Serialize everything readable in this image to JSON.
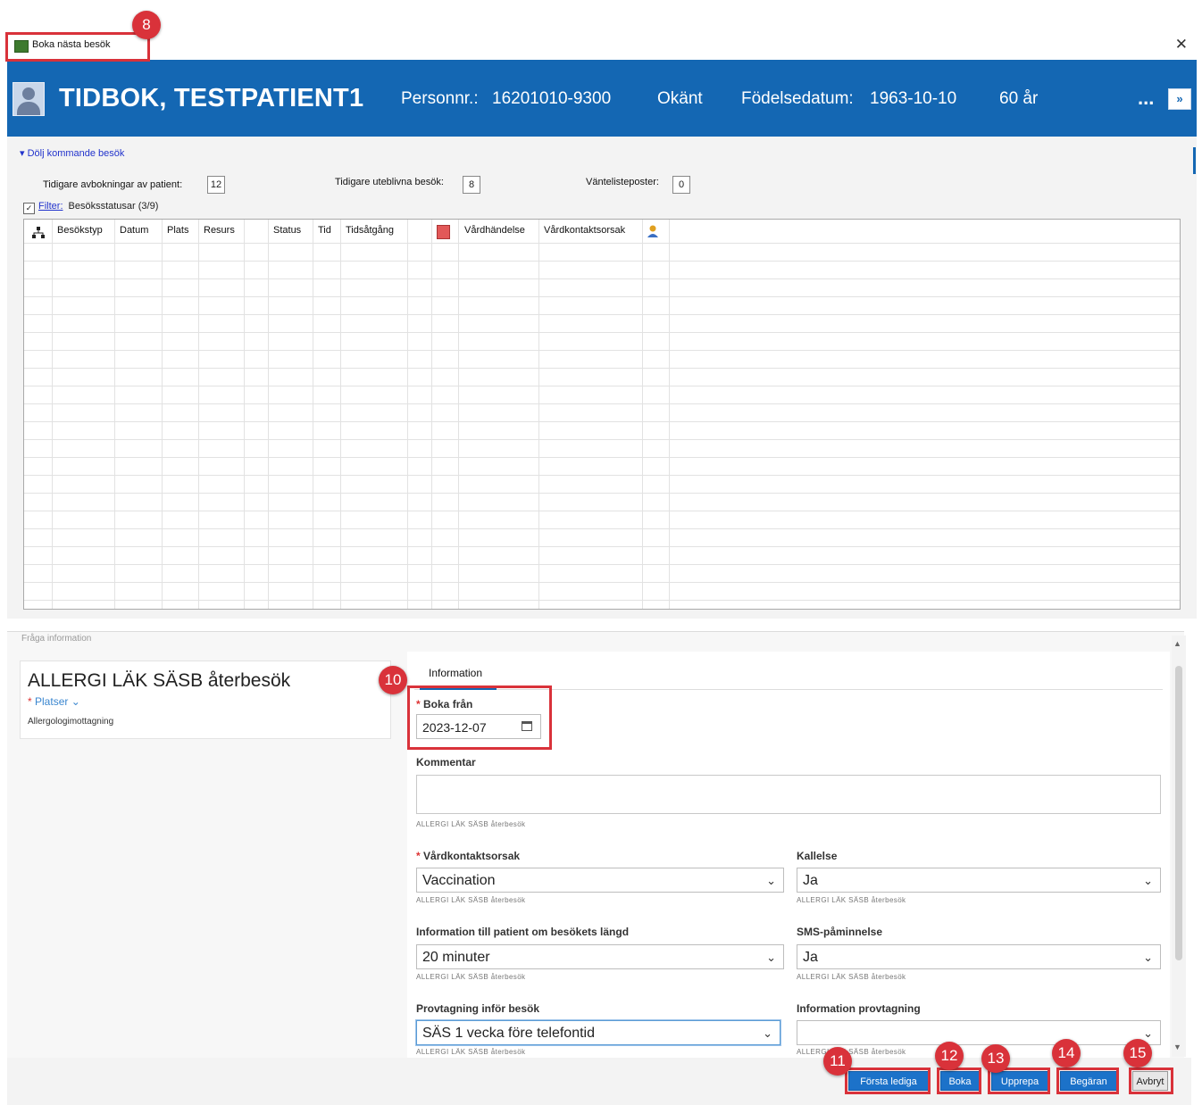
{
  "window": {
    "title": "Boka nästa besök"
  },
  "patient": {
    "name": "TIDBOK, TESTPATIENT1",
    "personnr_label": "Personnr.:",
    "personnr": "16201010-9300",
    "gender": "Okänt",
    "dob_label": "Födelsedatum:",
    "dob": "1963-10-10",
    "age": "60 år",
    "more": "...",
    "expand": "»"
  },
  "upcoming": {
    "toggle_label": "Dölj kommande besök",
    "prior_cancellations_label": "Tidigare avbokningar av patient:",
    "prior_cancellations": "12",
    "prior_noshows_label": "Tidigare uteblivna besök:",
    "prior_noshows": "8",
    "waitlist_label": "Väntelisteposter:",
    "waitlist": "0",
    "filter_link": "Filter:",
    "filter_status": "Besöksstatusar (3/9)"
  },
  "table": {
    "columns": [
      "Besökstyp",
      "Datum",
      "Plats",
      "Resurs",
      "Status",
      "Tid",
      "Tidsåtgång",
      "Vårdhändelse",
      "Vårdkontaktsorsak"
    ],
    "rows": []
  },
  "lower": {
    "section_label": "Fråga information",
    "visit_title": "ALLERGI LÄK SÄSB återbesök",
    "platser_label": "Platser",
    "clinic": "Allergologimottagning",
    "tab_information": "Information",
    "boka_fran_label": "Boka från",
    "boka_fran_value": "2023-12-07",
    "kommentar_label": "Kommentar",
    "source_hint": "ALLERGI LÄK SÄSB återbesök",
    "vardkontaktsorsak_label": "Vårdkontaktsorsak",
    "vardkontaktsorsak_value": "Vaccination",
    "kallelse_label": "Kallelse",
    "kallelse_value": "Ja",
    "info_langd_label": "Information till patient om besökets längd",
    "info_langd_value": "20 minuter",
    "sms_label": "SMS-påminnelse",
    "sms_value": "Ja",
    "provtagning_label": "Provtagning inför besök",
    "provtagning_value": "SÄS 1 vecka före telefontid",
    "info_provtagning_label": "Information provtagning",
    "info_provtagning_value": ""
  },
  "buttons": {
    "forsta_lediga": "Första lediga",
    "boka": "Boka",
    "upprepa": "Upprepa",
    "begaran": "Begäran",
    "avbryt": "Avbryt"
  },
  "annotations": [
    "8",
    "10",
    "11",
    "12",
    "13",
    "14",
    "15"
  ],
  "colors": {
    "header": "#1467b3",
    "annotation": "#d9323a",
    "button": "#1c72c9"
  }
}
